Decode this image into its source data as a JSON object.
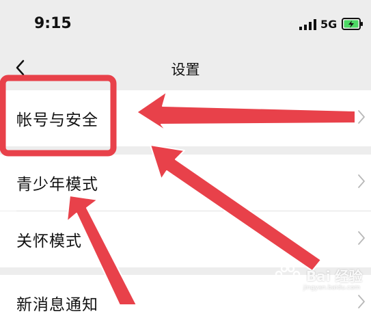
{
  "status_bar": {
    "time": "9:15",
    "network": "5G",
    "signal_icon": "signal-bars-icon",
    "battery_icon": "battery-charging-icon"
  },
  "nav": {
    "title": "设置",
    "back_icon": "chevron-left-icon"
  },
  "menu": {
    "items": [
      {
        "label": "帐号与安全",
        "icon": "chevron-right-icon"
      },
      {
        "label": "青少年模式",
        "icon": "chevron-right-icon"
      },
      {
        "label": "关怀模式",
        "icon": "chevron-right-icon"
      },
      {
        "label": "新消息通知",
        "icon": "chevron-right-icon"
      }
    ]
  },
  "watermark": {
    "text": "Bai 经验",
    "sub": "jingyan.baidu.com"
  },
  "colors": {
    "background": "#ededed",
    "row": "#ffffff",
    "annotation": "#e8414a",
    "battery": "#4cd964"
  }
}
